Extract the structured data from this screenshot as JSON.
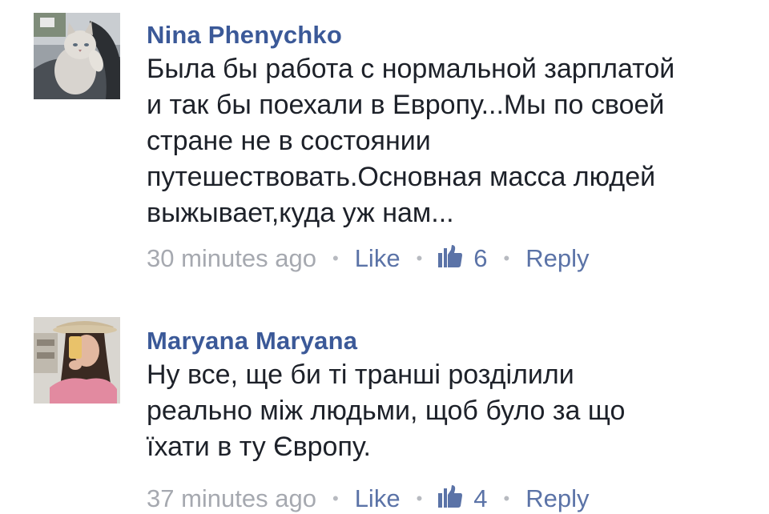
{
  "comments": [
    {
      "author": "Nina Phenychko",
      "text": "Была бы работа с нормальной зарплатой\nи так бы поехали в Европу...Мы по своей\nстране не в состоянии\nпутешествовать.Основная масса людей\nвыжывает,куда уж нам...",
      "timestamp": "30 minutes ago",
      "like_label": "Like",
      "like_count": "6",
      "reply_label": "Reply",
      "separator": "•",
      "avatar_icon": "cat-profile-photo"
    },
    {
      "author": "Maryana Maryana",
      "text": "Ну все, ще би ті транші розділили\nреально між людьми, щоб було за що\nїхати в ту Європу.",
      "timestamp": "37 minutes ago",
      "like_label": "Like",
      "like_count": "4",
      "reply_label": "Reply",
      "separator": "•",
      "avatar_icon": "woman-selfie-profile-photo"
    }
  ],
  "colors": {
    "author": "#3b5998",
    "text": "#1d2129",
    "meta": "#a6a9b0",
    "action_link": "#5b73a7",
    "background": "#ffffff"
  },
  "icons": {
    "like_count_icon": "thumbs-up-icon"
  }
}
